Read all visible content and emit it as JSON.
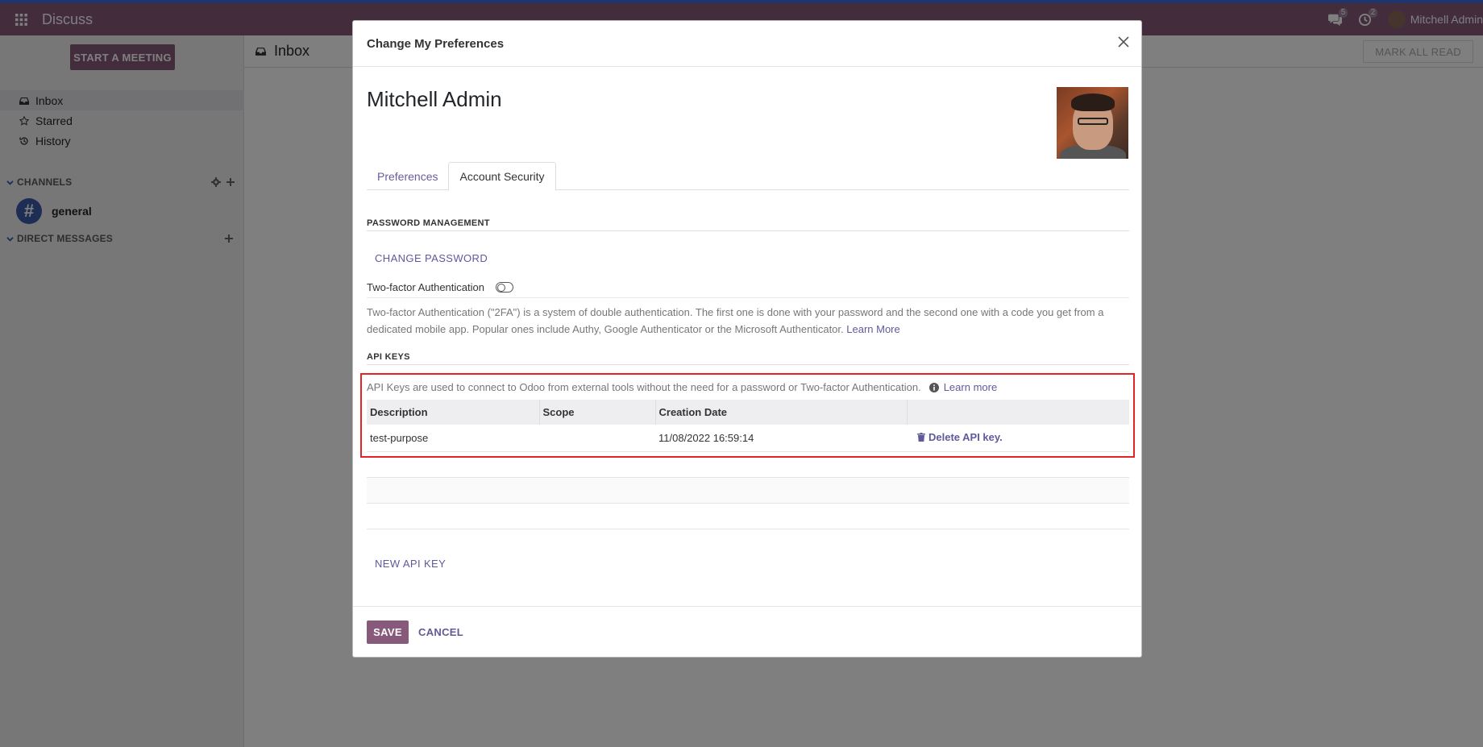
{
  "navbar": {
    "app_name": "Discuss",
    "messages_badge": "5",
    "activities_badge": "2",
    "user_name": "Mitchell Admin"
  },
  "sidebar": {
    "start_meeting": "START A MEETING",
    "items": [
      {
        "label": "Inbox",
        "icon": "inbox-icon"
      },
      {
        "label": "Starred",
        "icon": "star-icon"
      },
      {
        "label": "History",
        "icon": "history-icon"
      }
    ],
    "channels_header": "CHANNELS",
    "channel_general": "general",
    "dm_header": "DIRECT MESSAGES"
  },
  "main": {
    "title": "Inbox",
    "mark_all_read": "MARK ALL READ"
  },
  "modal": {
    "title": "Change My Preferences",
    "user_name": "Mitchell Admin",
    "tabs": [
      "Preferences",
      "Account Security"
    ],
    "active_tab": "Account Security",
    "password_section": "PASSWORD MANAGEMENT",
    "change_password": "CHANGE PASSWORD",
    "twofa_label": "Two-factor Authentication",
    "twofa_desc": "Two-factor Authentication (\"2FA\") is a system of double authentication. The first one is done with your password and the second one with a code you get from a dedicated mobile app. Popular ones include Authy, Google Authenticator or the Microsoft Authenticator.",
    "twofa_learn_more": "Learn More",
    "api_section": "API KEYS",
    "api_desc": "API Keys are used to connect to Odoo from external tools without the need for a password or Two-factor Authentication.",
    "api_learn_more": "Learn more",
    "api_table": {
      "columns": [
        "Description",
        "Scope",
        "Creation Date",
        ""
      ],
      "rows": [
        {
          "description": "test-purpose",
          "scope": "",
          "creation_date": "11/08/2022 16:59:14",
          "action": "Delete API key."
        }
      ]
    },
    "new_api_key": "NEW API KEY",
    "save": "SAVE",
    "cancel": "CANCEL"
  },
  "colors": {
    "brand": "#875a7b",
    "link": "#5f5a9a",
    "highlight_border": "#e32326"
  }
}
